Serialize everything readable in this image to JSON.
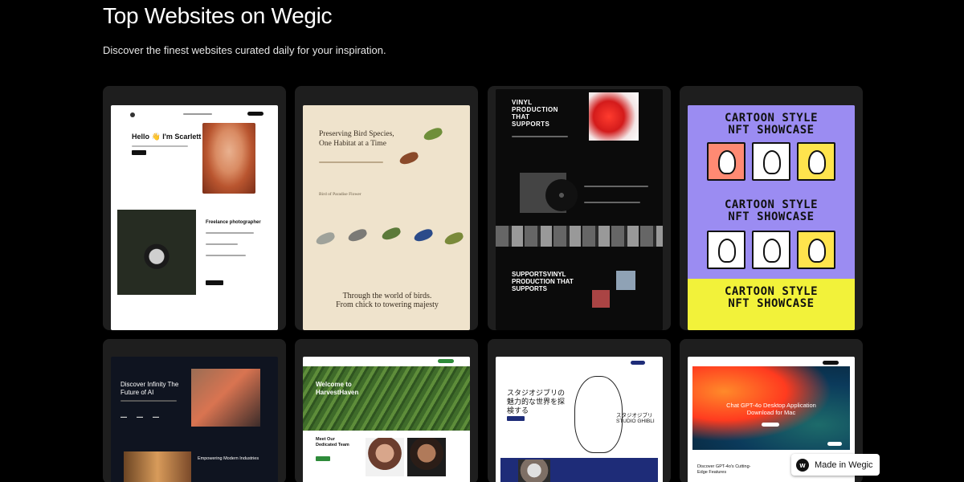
{
  "header": {
    "title": "Top Websites on Wegic",
    "subtitle": "Discover the finest websites curated daily for your inspiration."
  },
  "cards": [
    {
      "hello": "Hello 👋 I'm Scarlett",
      "role": "Freelance photographer"
    },
    {
      "hero": "Preserving Bird Species, One Habitat at a Time",
      "caption": "Bird of Paradise Flower",
      "footer": "Through the world of birds. From chick to towering majesty"
    },
    {
      "hero": "VINYL PRODUCTION THAT SUPPORTS",
      "footer": "SUPPORTSVINYL PRODUCTION THAT SUPPORTS"
    },
    {
      "heading": "CARTOON STYLE NFT SHOWCASE"
    },
    {
      "hero": "Discover Infinity The Future of AI",
      "section": "Empowering Modern Industries"
    },
    {
      "hero": "Welcome to HarvestHaven",
      "team": "Meet Our Dedicated Team"
    },
    {
      "hero": "スタジオジブリの魅力的な世界を探検する",
      "brand": "スタジオジブリ STUDIO GHIBLI"
    },
    {
      "hero": "Chat GPT-4o Desktop Application Download for Mac",
      "section": "Discover GPT-4o's Cutting-Edge Features"
    }
  ],
  "badge": {
    "label": "Made in Wegic"
  }
}
